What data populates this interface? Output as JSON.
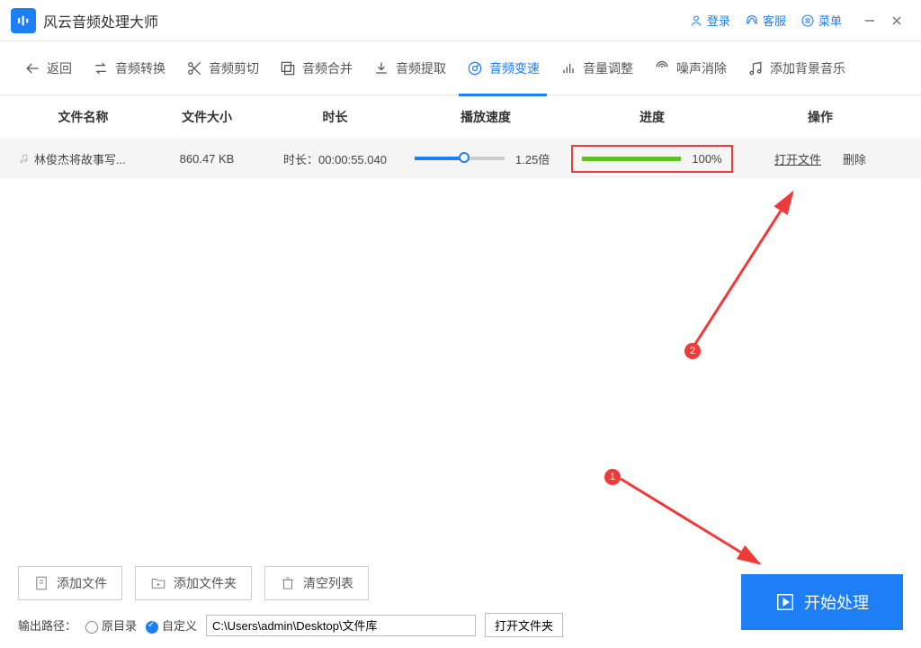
{
  "app": {
    "title": "风云音频处理大师"
  },
  "titlebar": {
    "login": "登录",
    "support": "客服",
    "menu": "菜单"
  },
  "toolbar": {
    "back": "返回",
    "items": [
      {
        "label": "音频转换"
      },
      {
        "label": "音频剪切"
      },
      {
        "label": "音频合并"
      },
      {
        "label": "音频提取"
      },
      {
        "label": "音频变速",
        "active": true
      },
      {
        "label": "音量调整"
      },
      {
        "label": "噪声消除"
      },
      {
        "label": "添加背景音乐"
      }
    ]
  },
  "table": {
    "headers": {
      "name": "文件名称",
      "size": "文件大小",
      "duration": "时长",
      "speed": "播放速度",
      "progress": "进度",
      "action": "操作"
    },
    "row": {
      "name": "林俊杰将故事写...",
      "size": "860.47 KB",
      "duration_label": "时长：00:00:55.040",
      "speed_label": "1.25倍",
      "speed_pct": 55,
      "progress_text": "100%",
      "open": "打开文件",
      "delete": "删除"
    }
  },
  "annotations": {
    "badge1": "1",
    "badge2": "2"
  },
  "bottom": {
    "add_file": "添加文件",
    "add_folder": "添加文件夹",
    "clear_list": "清空列表",
    "output_label": "输出路径：",
    "radio_original": "原目录",
    "radio_custom": "自定义",
    "path": "C:\\Users\\admin\\Desktop\\文件库",
    "open_folder": "打开文件夹",
    "start": "开始处理"
  }
}
